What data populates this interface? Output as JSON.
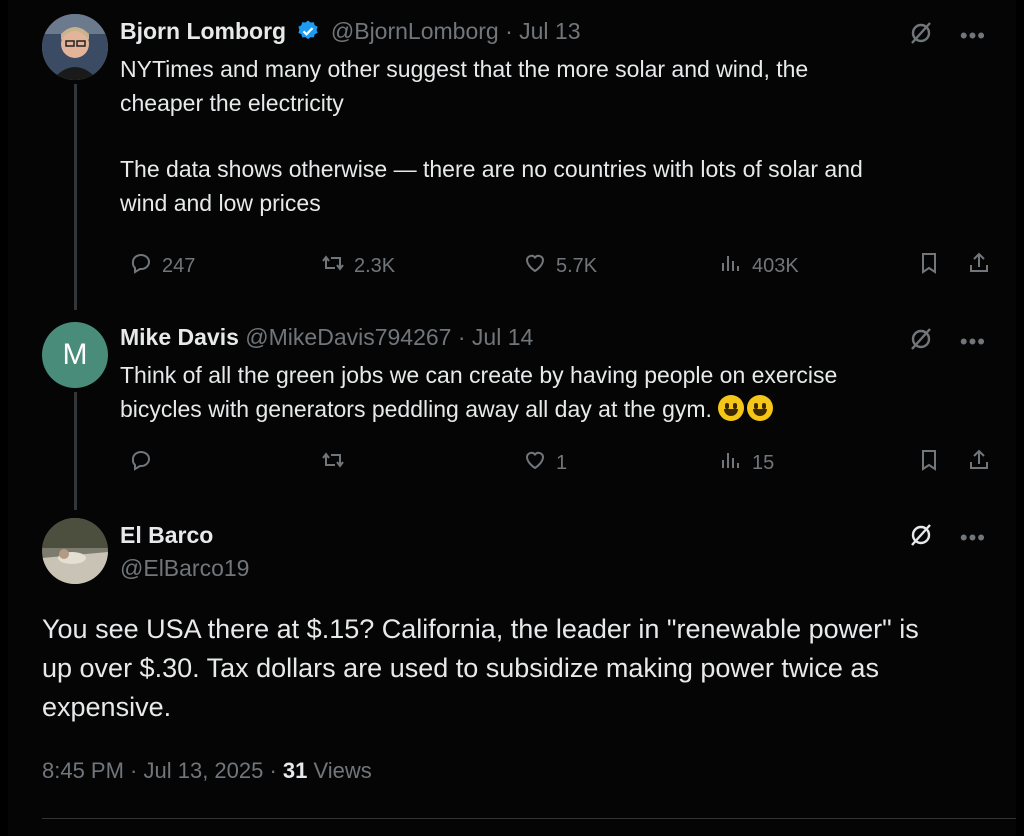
{
  "tweets": [
    {
      "name": "Bjorn Lomborg",
      "handle": "@BjornLomborg",
      "date": "· Jul 13",
      "line1": "NYTimes and many other suggest that the more solar and wind, the",
      "line2": "cheaper the electricity",
      "line3": "The data shows otherwise — there are no countries with lots of solar and",
      "line4": "wind and low prices",
      "replies": "247",
      "reposts": "2.3K",
      "likes": "5.7K",
      "views": "403K"
    },
    {
      "name": "Mike Davis",
      "handle": "@MikeDavis794267",
      "date": "· Jul 14",
      "avatar_letter": "M",
      "line1": "Think of all the green jobs we can create by having people on exercise",
      "line2": "bicycles with generators peddling away all day at the gym.",
      "replies": "",
      "reposts": "",
      "likes": "1",
      "views": "15"
    }
  ],
  "main": {
    "name": "El Barco",
    "handle": "@ElBarco19",
    "line1": "You see USA there at $.15?  California, the leader in \"renewable power\" is",
    "line2": "up over $.30.  Tax dollars are used to subsidize making power twice as",
    "line3": "expensive.",
    "time": "8:45 PM · Jul 13, 2025 · ",
    "views_count": "31",
    "views_label": " Views"
  },
  "colors": {
    "verified": "#1d9bf0",
    "muted": "#71767b",
    "text": "#e7e9ea",
    "avatar_m": "#4a8c7a"
  },
  "icons": [
    "verified-badge-icon",
    "grok-icon",
    "more-icon",
    "reply-icon",
    "repost-icon",
    "like-icon",
    "views-icon",
    "bookmark-icon",
    "share-icon",
    "grinning-emoji-icon"
  ]
}
